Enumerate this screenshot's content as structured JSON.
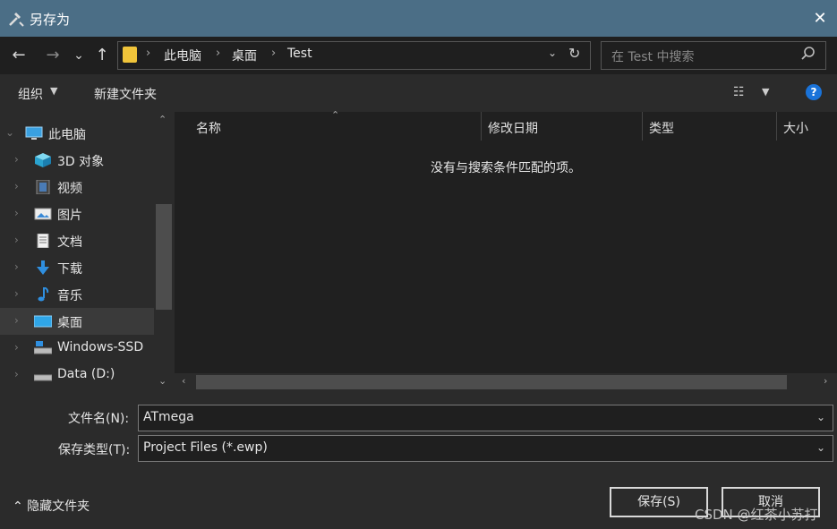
{
  "window": {
    "title": "另存为",
    "close_glyph": "✕"
  },
  "nav": {
    "back": "←",
    "forward": "→",
    "recent": "⌄",
    "up": "↑",
    "breadcrumbs": [
      "此电脑",
      "桌面",
      "Test"
    ],
    "separator": "›",
    "dropdown": "⌄",
    "refresh": "↻",
    "search_placeholder": "在 Test 中搜索",
    "search_icon": "search-icon"
  },
  "toolbar": {
    "organize": "组织",
    "organize_caret": "▼",
    "new_folder": "新建文件夹",
    "view_glyph": "☷",
    "view_caret": "▼",
    "help": "?"
  },
  "sidebar": {
    "items": [
      {
        "label": "此电脑",
        "icon": "computer-icon",
        "expanded": true
      },
      {
        "label": "3D 对象",
        "icon": "cube-icon"
      },
      {
        "label": "视频",
        "icon": "video-icon"
      },
      {
        "label": "图片",
        "icon": "picture-icon"
      },
      {
        "label": "文档",
        "icon": "document-icon"
      },
      {
        "label": "下载",
        "icon": "download-icon"
      },
      {
        "label": "音乐",
        "icon": "music-icon"
      },
      {
        "label": "桌面",
        "icon": "desktop-icon",
        "selected": true
      },
      {
        "label": "Windows-SSD",
        "icon": "drive-icon"
      },
      {
        "label": "Data (D:)",
        "icon": "drive-icon"
      }
    ]
  },
  "content": {
    "columns": [
      "名称",
      "修改日期",
      "类型",
      "大小"
    ],
    "empty_message": "没有与搜索条件匹配的项。"
  },
  "form": {
    "filename_label": "文件名(N):",
    "filename_value": "ATmega",
    "filetype_label": "保存类型(T):",
    "filetype_value": "Project Files (*.ewp)"
  },
  "footer": {
    "hide_folders": "⌃ 隐藏文件夹",
    "save": "保存(S)",
    "cancel": "取消",
    "watermark": "CSDN @红茶小苏打"
  },
  "colors": {
    "titlebar": "#4b6e86",
    "folder": "#f0c43a",
    "help": "#1a73d9"
  }
}
